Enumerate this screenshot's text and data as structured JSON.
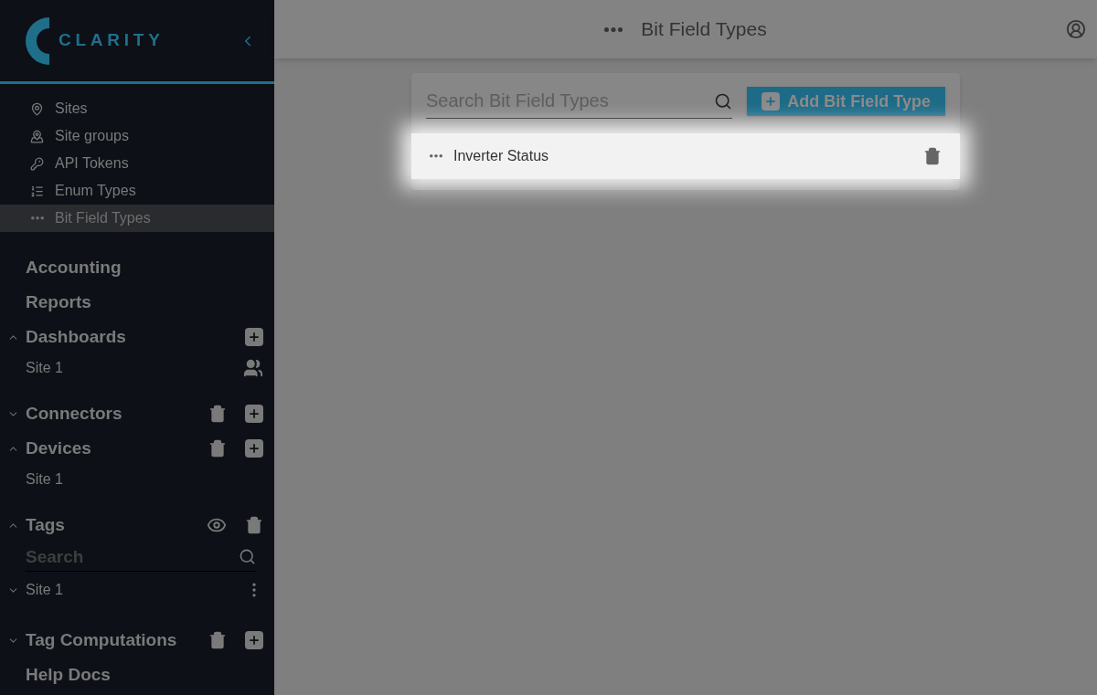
{
  "brand": {
    "name": "CLARITY"
  },
  "nav_items": [
    {
      "label": "Sites",
      "selected": false
    },
    {
      "label": "Site groups",
      "selected": false
    },
    {
      "label": "API Tokens",
      "selected": false
    },
    {
      "label": "Enum Types",
      "selected": false
    },
    {
      "label": "Bit Field Types",
      "selected": true
    }
  ],
  "sections": [
    {
      "kind": "link",
      "label": "Accounting"
    },
    {
      "kind": "link",
      "label": "Reports"
    },
    {
      "kind": "tree",
      "label": "Dashboards",
      "expanded": true,
      "actions": [
        {
          "kind": "add"
        }
      ],
      "children": [
        {
          "kind": "item",
          "label": "Site 1",
          "actions": [
            {
              "kind": "people"
            }
          ]
        }
      ]
    },
    {
      "kind": "tree",
      "label": "Connectors",
      "expanded": false,
      "actions": [
        {
          "kind": "delete"
        },
        {
          "kind": "add"
        }
      ]
    },
    {
      "kind": "tree",
      "label": "Devices",
      "expanded": true,
      "actions": [
        {
          "kind": "delete"
        },
        {
          "kind": "add"
        }
      ],
      "children": [
        {
          "kind": "item",
          "label": "Site 1"
        }
      ]
    },
    {
      "kind": "tree",
      "label": "Tags",
      "expanded": true,
      "actions": [
        {
          "kind": "view"
        },
        {
          "kind": "delete"
        }
      ],
      "children": [
        {
          "kind": "search",
          "placeholder": "Search"
        },
        {
          "kind": "group",
          "label": "Site 1",
          "expanded": false,
          "actions": [
            {
              "kind": "more"
            }
          ]
        }
      ]
    },
    {
      "kind": "tree",
      "label": "Tag Computations",
      "expanded": false,
      "actions": [
        {
          "kind": "delete"
        },
        {
          "kind": "add"
        }
      ]
    },
    {
      "kind": "link",
      "label": "Help Docs"
    }
  ],
  "header": {
    "title": "Bit Field Types"
  },
  "search": {
    "placeholder": "Search Bit Field Types"
  },
  "add_button": {
    "label": "Add Bit Field Type"
  },
  "rows": [
    {
      "label": "Inverter Status",
      "highlighted": true
    }
  ]
}
